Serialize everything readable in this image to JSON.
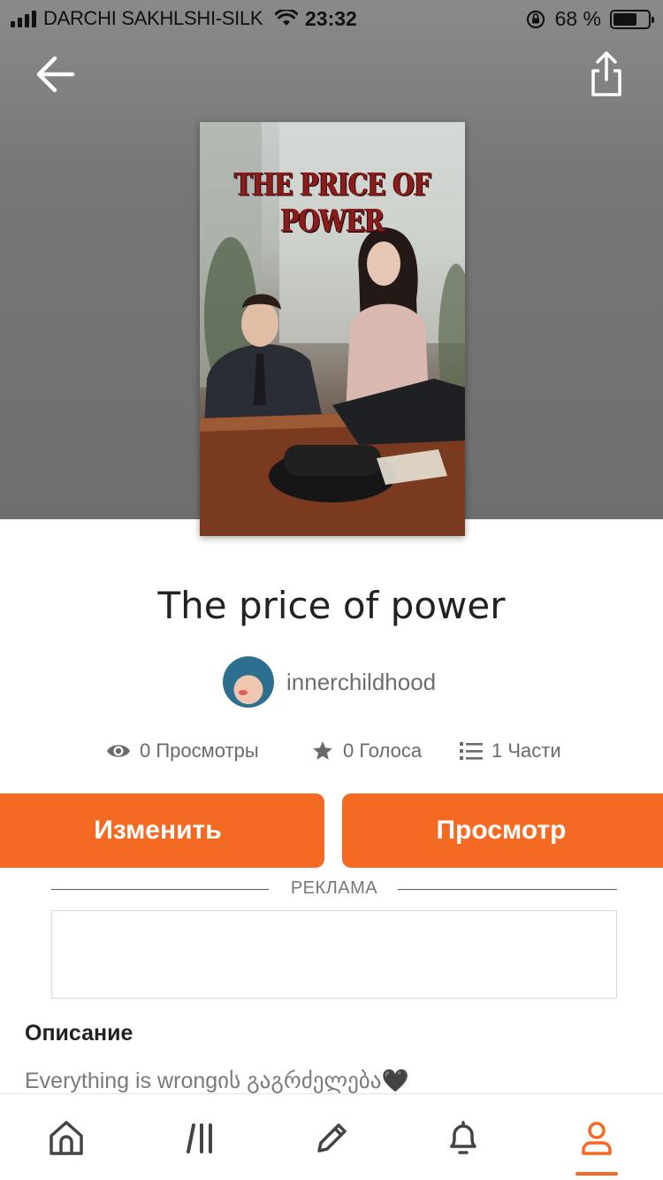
{
  "status_bar": {
    "carrier": "DARCHI SAKHLSHI-SILK",
    "time": "23:32",
    "battery_percent": "68 %",
    "battery_level": 0.68
  },
  "header": {
    "back_icon": "arrow-left-icon",
    "share_icon": "share-icon"
  },
  "cover": {
    "title_text": "THE PRICE OF POWER"
  },
  "story": {
    "title": "The price of power",
    "author": "innerchildhood"
  },
  "stats": {
    "views": "0 Просмотры",
    "votes": "0 Голоса",
    "parts": "1 Части"
  },
  "actions": {
    "edit_label": "Изменить",
    "view_label": "Просмотр"
  },
  "ad": {
    "label": "РЕКЛАМА"
  },
  "description": {
    "heading": "Описание",
    "text": "Everything is wrongის გაგრძელება🖤"
  },
  "tabbar": {
    "items": [
      "home-icon",
      "library-icon",
      "write-icon",
      "notifications-icon",
      "profile-icon"
    ],
    "active": "profile-icon"
  },
  "colors": {
    "accent": "#f56a22",
    "hero_bg": "#767676"
  }
}
